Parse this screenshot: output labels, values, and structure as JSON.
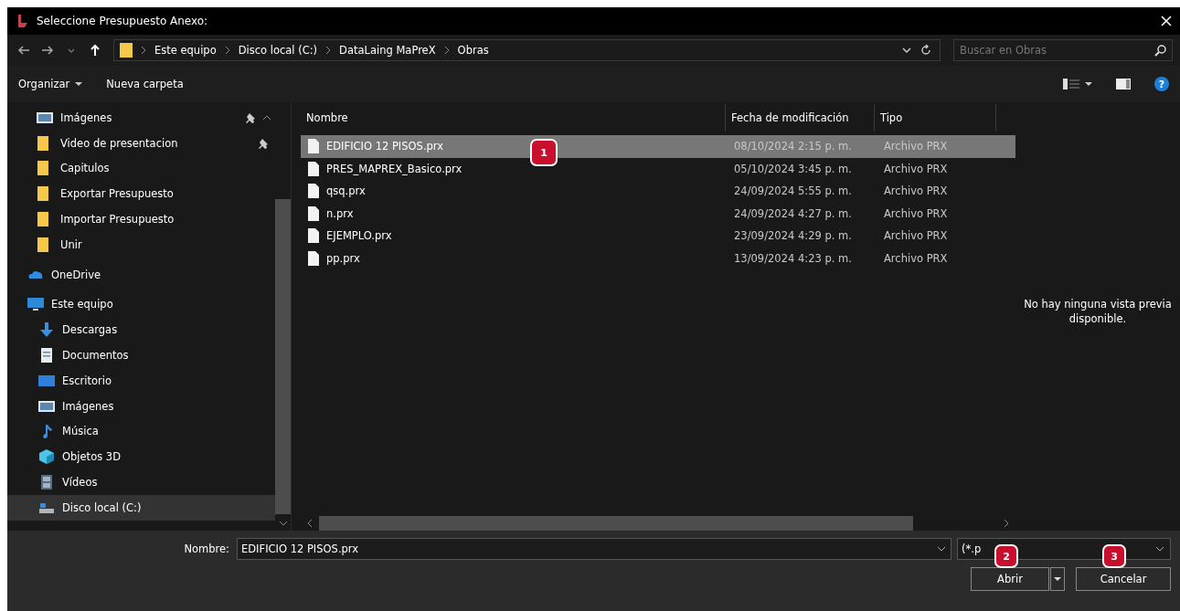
{
  "window": {
    "title": "Seleccione Presupuesto Anexo:"
  },
  "breadcrumb": [
    "Este equipo",
    "Disco local (C:)",
    "DataLaing MaPreX",
    "Obras"
  ],
  "search": {
    "placeholder": "Buscar en Obras"
  },
  "toolbar": {
    "organize": "Organizar",
    "new_folder": "Nueva carpeta",
    "help": "?"
  },
  "sidebar": {
    "quick_access": [
      {
        "label": "Imágenes",
        "kind": "pictures",
        "pinned": true
      },
      {
        "label": "Video de presentacion",
        "kind": "folder",
        "pinned": true
      },
      {
        "label": "Capitulos",
        "kind": "folder",
        "pinned": false
      },
      {
        "label": "Exportar Presupuesto",
        "kind": "folder",
        "pinned": false
      },
      {
        "label": "Importar Presupuesto",
        "kind": "folder",
        "pinned": false
      },
      {
        "label": "Unir",
        "kind": "folder",
        "pinned": false
      }
    ],
    "locations": [
      {
        "label": "OneDrive",
        "kind": "cloud",
        "selected": false
      },
      {
        "label": "Este equipo",
        "kind": "pc",
        "selected": false,
        "children": [
          {
            "label": "Descargas",
            "kind": "download",
            "selected": false
          },
          {
            "label": "Documentos",
            "kind": "document",
            "selected": false
          },
          {
            "label": "Escritorio",
            "kind": "desktop",
            "selected": false
          },
          {
            "label": "Imágenes",
            "kind": "pictures",
            "selected": false
          },
          {
            "label": "Música",
            "kind": "music",
            "selected": false
          },
          {
            "label": "Objetos 3D",
            "kind": "cube",
            "selected": false
          },
          {
            "label": "Vídeos",
            "kind": "video",
            "selected": false
          },
          {
            "label": "Disco local (C:)",
            "kind": "drive",
            "selected": true
          }
        ]
      }
    ]
  },
  "table": {
    "columns": [
      "Nombre",
      "Fecha de modificación",
      "Tipo"
    ],
    "rows": [
      {
        "name": "EDIFICIO 12 PISOS.prx",
        "date": "08/10/2024 2:15 p. m.",
        "type": "Archivo PRX",
        "selected": true
      },
      {
        "name": "PRES_MAPREX_Basico.prx",
        "date": "05/10/2024 3:45 p. m.",
        "type": "Archivo PRX",
        "selected": false
      },
      {
        "name": "qsq.prx",
        "date": "24/09/2024 5:55 p. m.",
        "type": "Archivo PRX",
        "selected": false
      },
      {
        "name": "n.prx",
        "date": "24/09/2024 4:27 p. m.",
        "type": "Archivo PRX",
        "selected": false
      },
      {
        "name": "EJEMPLO.prx",
        "date": "23/09/2024 4:29 p. m.",
        "type": "Archivo PRX",
        "selected": false
      },
      {
        "name": "pp.prx",
        "date": "13/09/2024 4:23 p. m.",
        "type": "Archivo PRX",
        "selected": false
      }
    ]
  },
  "preview": {
    "message": "No hay ninguna vista previa disponible."
  },
  "footer": {
    "name_label": "Nombre:",
    "name_value": "EDIFICIO 12 PISOS.prx",
    "filter": "(*.p",
    "open": "Abrir",
    "cancel": "Cancelar"
  },
  "annotations": [
    {
      "label": "1"
    },
    {
      "label": "2"
    },
    {
      "label": "3"
    }
  ]
}
